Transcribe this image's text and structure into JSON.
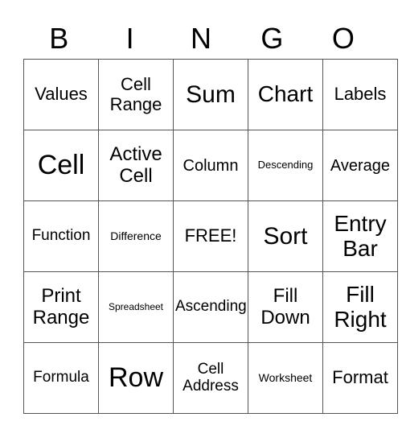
{
  "header": [
    "B",
    "I",
    "N",
    "G",
    "O"
  ],
  "board": [
    [
      {
        "text": "Values",
        "size": "s22"
      },
      {
        "text": "Cell Range",
        "size": "s22"
      },
      {
        "text": "Sum",
        "size": "s30"
      },
      {
        "text": "Chart",
        "size": "s28"
      },
      {
        "text": "Labels",
        "size": "s22"
      }
    ],
    [
      {
        "text": "Cell",
        "size": "s36"
      },
      {
        "text": "Active Cell",
        "size": "s24"
      },
      {
        "text": "Column",
        "size": "s20"
      },
      {
        "text": "Descending",
        "size": "s13"
      },
      {
        "text": "Average",
        "size": "s20"
      }
    ],
    [
      {
        "text": "Function",
        "size": "s18"
      },
      {
        "text": "Difference",
        "size": "s14"
      },
      {
        "text": "FREE!",
        "size": "s22"
      },
      {
        "text": "Sort",
        "size": "s30"
      },
      {
        "text": "Entry Bar",
        "size": "s28"
      }
    ],
    [
      {
        "text": "Print Range",
        "size": "s24"
      },
      {
        "text": "Spreadsheet",
        "size": "s12"
      },
      {
        "text": "Ascending",
        "size": "s18"
      },
      {
        "text": "Fill Down",
        "size": "s24"
      },
      {
        "text": "Fill Right",
        "size": "s28"
      }
    ],
    [
      {
        "text": "Formula",
        "size": "s18"
      },
      {
        "text": "Row",
        "size": "s36"
      },
      {
        "text": "Cell Address",
        "size": "s18"
      },
      {
        "text": "Worksheet",
        "size": "s14"
      },
      {
        "text": "Format",
        "size": "s22"
      }
    ]
  ]
}
